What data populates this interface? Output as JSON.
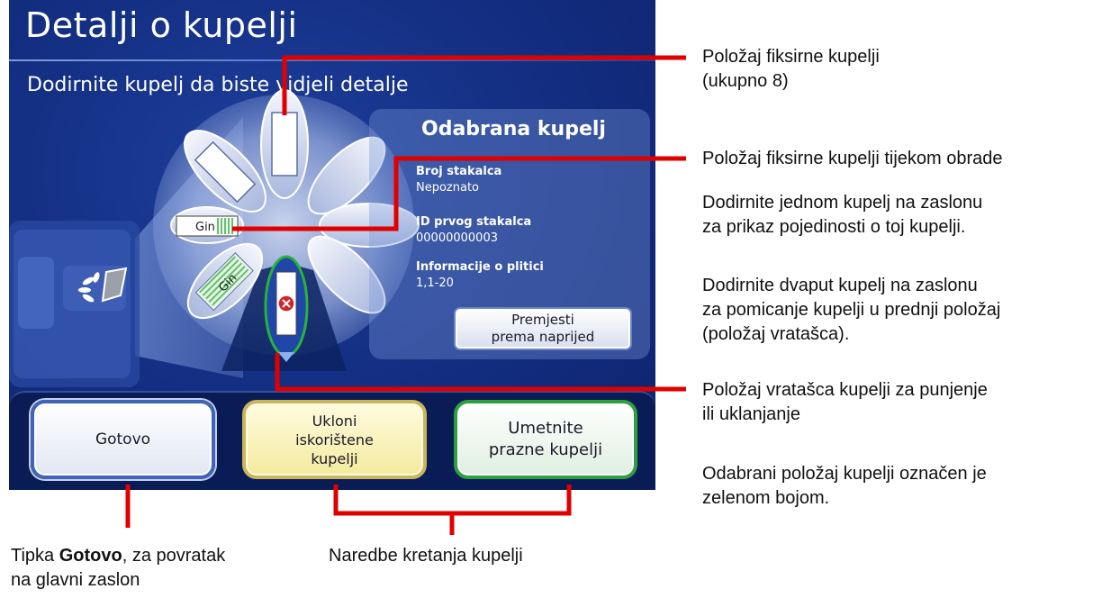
{
  "screen": {
    "title": "Detalji o kupelji",
    "subtitle": "Dodirnite kupelj da biste vidjeli detalje",
    "carousel": {
      "slot_label_processing": "Gin",
      "slot_label_striped": "Gin",
      "total_positions": 8,
      "selected_color": "#27b33b"
    },
    "panel": {
      "title": "Odabrana kupelj",
      "slide_count_label": "Broj stakalca",
      "slide_count_value": "Nepoznato",
      "first_slide_label": "ID prvog stakalca",
      "first_slide_value": "00000000003",
      "plate_info_label": "Informacije o plitici",
      "plate_info_value": "1,1-20",
      "move_button_line1": "Premjesti",
      "move_button_line2": "prema naprijed"
    },
    "buttons": {
      "done": "Gotovo",
      "remove_line1": "Ukloni",
      "remove_line2": "iskorištene",
      "remove_line3": "kupelji",
      "insert_line1": "Umetnite",
      "insert_line2": "prazne kupelji"
    }
  },
  "callouts": {
    "fixed_positions_line1": "Položaj fiksirne kupelji",
    "fixed_positions_line2": "(ukupno 8)",
    "processing_position": "Položaj fiksirne kupelji tijekom obrade",
    "single_tap_line1": "Dodirnite jednom kupelj na zaslonu",
    "single_tap_line2": "za prikaz pojedinosti o toj kupelji.",
    "double_tap_line1": "Dodirnite dvaput kupelj na zaslonu",
    "double_tap_line2": "za pomicanje kupelji u prednji položaj",
    "double_tap_line3": "(položaj vratašca).",
    "door_position_line1": "Položaj vratašca kupelji za punjenje",
    "door_position_line2": "ili uklanjanje",
    "selected_note_line1": "Odabrani položaj kupelji označen je",
    "selected_note_line2": "zelenom bojom.",
    "done_key_prefix": "Tipka ",
    "done_key_bold": "Gotovo",
    "done_key_suffix": ", za povratak",
    "done_key_line2": "na glavni zaslon",
    "movement_commands": "Naredbe kretanja kupelji"
  },
  "colors": {
    "screen_blue": "#143085",
    "callout_line": "#e00000",
    "selected_outline": "#27b33b",
    "error_icon": "#d2232a"
  }
}
